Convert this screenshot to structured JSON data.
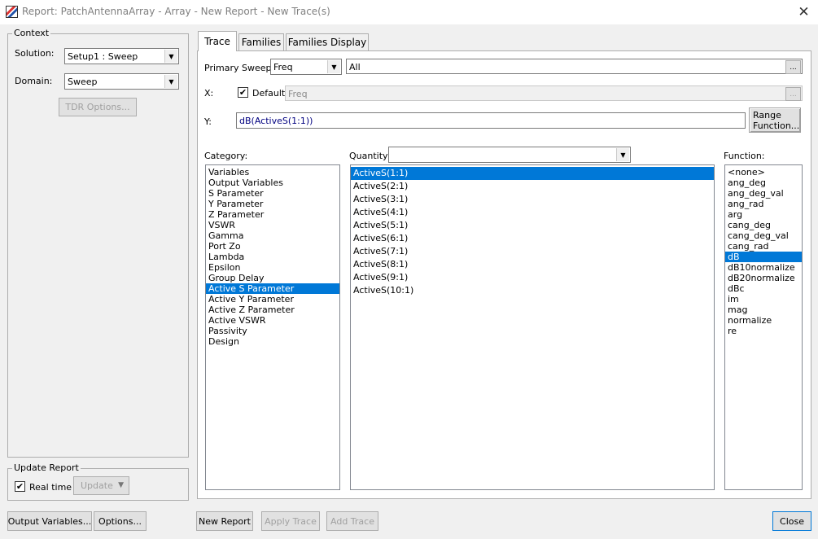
{
  "window": {
    "title": "Report: PatchAntennaArray - Array - New Report - New Trace(s)",
    "close_glyph": "✕"
  },
  "context": {
    "legend": "Context",
    "solution_label": "Solution:",
    "solution_value": "Setup1 : Sweep",
    "domain_label": "Domain:",
    "domain_value": "Sweep",
    "tdr_button": "TDR Options..."
  },
  "update_report": {
    "legend": "Update Report",
    "realtime_label": "Real time",
    "realtime_checked": true,
    "update_button": "Update"
  },
  "tabs": [
    {
      "label": "Trace",
      "active": true
    },
    {
      "label": "Families",
      "active": false
    },
    {
      "label": "Families Display",
      "active": false
    }
  ],
  "trace": {
    "primary_sweep_label": "Primary Sweep:",
    "primary_sweep_value": "Freq",
    "primary_sweep_range": "All",
    "x_label": "X:",
    "x_default_label": "Default",
    "x_default_checked": true,
    "x_value": "Freq",
    "y_label": "Y:",
    "y_value": "dB(ActiveS(1:1))",
    "range_function_button": "Range\nFunction...",
    "category_label": "Category:",
    "quantity_label": "Quantity:",
    "quantity_filter": "",
    "function_label": "Function:",
    "categories": [
      "Variables",
      "Output Variables",
      "S Parameter",
      "Y Parameter",
      "Z Parameter",
      "VSWR",
      "Gamma",
      "Port Zo",
      "Lambda",
      "Epsilon",
      "Group Delay",
      "Active S Parameter",
      "Active Y Parameter",
      "Active Z Parameter",
      "Active VSWR",
      "Passivity",
      "Design"
    ],
    "selected_category": "Active S Parameter",
    "quantities": [
      "ActiveS(1:1)",
      "ActiveS(2:1)",
      "ActiveS(3:1)",
      "ActiveS(4:1)",
      "ActiveS(5:1)",
      "ActiveS(6:1)",
      "ActiveS(7:1)",
      "ActiveS(8:1)",
      "ActiveS(9:1)",
      "ActiveS(10:1)"
    ],
    "selected_quantity": "ActiveS(1:1)",
    "functions": [
      "<none>",
      "ang_deg",
      "ang_deg_val",
      "ang_rad",
      "arg",
      "cang_deg",
      "cang_deg_val",
      "cang_rad",
      "dB",
      "dB10normalize",
      "dB20normalize",
      "dBc",
      "im",
      "mag",
      "normalize",
      "re"
    ],
    "selected_function": "dB"
  },
  "bottom": {
    "output_variables_button": "Output Variables...",
    "options_button": "Options...",
    "new_report_button": "New Report",
    "apply_trace_button": "Apply Trace",
    "add_trace_button": "Add Trace",
    "close_button": "Close"
  },
  "colors": {
    "selection": "#0078d7",
    "title_text": "#808080"
  }
}
